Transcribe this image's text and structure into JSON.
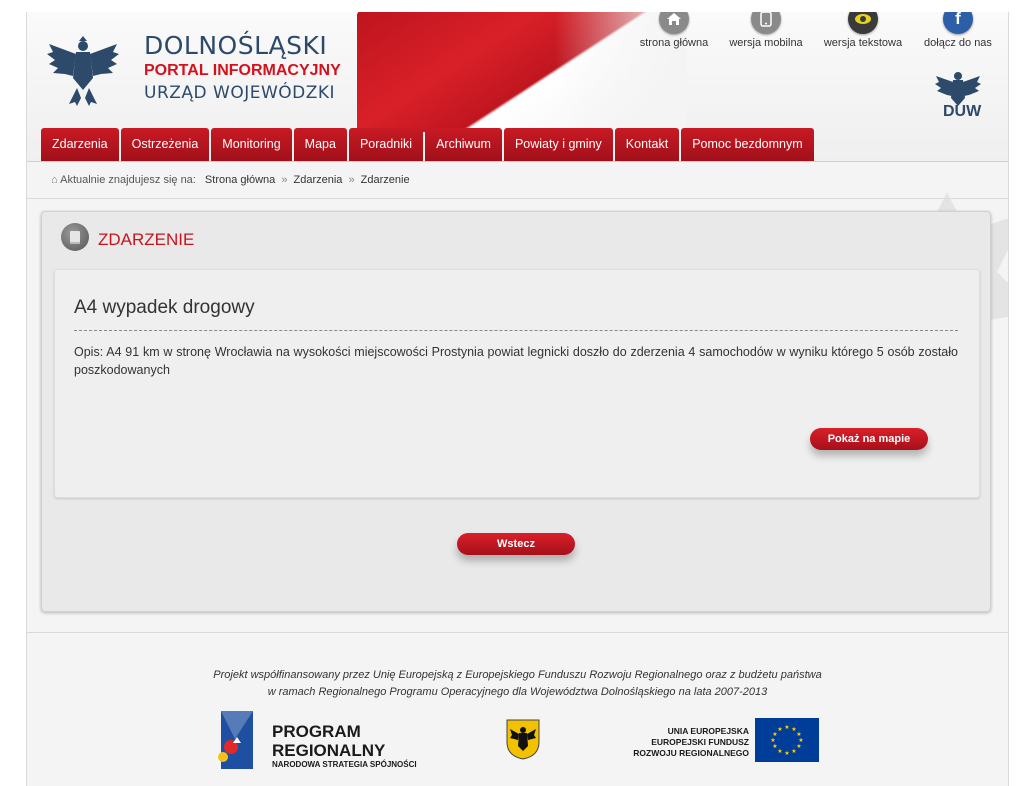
{
  "header": {
    "title_line1": "DOLNOŚLĄSKI",
    "title_line2": "PORTAL INFORMACYJNY",
    "title_line3": "URZĄD WOJEWÓDZKI",
    "duw_logo_text": "DUW",
    "top_links": [
      {
        "label": "strona główna",
        "icon": "home-icon",
        "color": "#8a8a8a"
      },
      {
        "label": "wersja mobilna",
        "icon": "mobile-icon",
        "color": "#8a8a8a"
      },
      {
        "label": "wersja tekstowa",
        "icon": "eye-icon",
        "color": "#3a3a3a"
      },
      {
        "label": "dołącz do nas",
        "icon": "facebook-icon",
        "color": "#2d5fa8"
      }
    ]
  },
  "nav": {
    "tabs": [
      "Zdarzenia",
      "Ostrzeżenia",
      "Monitoring",
      "Mapa",
      "Poradniki",
      "Archiwum",
      "Powiaty i gminy",
      "Kontakt",
      "Pomoc bezdomnym"
    ]
  },
  "breadcrumb": {
    "prefix": "Aktualnie znajdujesz się na:",
    "items": [
      "Strona główna",
      "Zdarzenia",
      "Zdarzenie"
    ]
  },
  "section": {
    "title": "ZDARZENIE",
    "event_title": "A4 wypadek drogowy",
    "description": "Opis: A4 91 km w stronę Wrocławia na wysokości miejscowości Prostynia powiat legnicki doszło do zderzenia 4 samochodów w wyniku którego 5 osób zostało poszkodowanych",
    "map_button": "Pokaż na mapie",
    "back_button": "Wstecz"
  },
  "footer": {
    "line1": "Projekt współfinansowany przez Unię Europejską z Europejskiego Funduszu Rozwoju Regionalnego oraz z budżetu państwa",
    "line2": "w ramach Regionalnego Programu Operacyjnego dla Województwa Dolnośląskiego na lata 2007-2013",
    "program_line1": "PROGRAM",
    "program_line2": "REGIONALNY",
    "program_line3": "NARODOWA STRATEGIA SPÓJNOŚCI",
    "ue_line1": "UNIA EUROPEJSKA",
    "ue_line2": "EUROPEJSKI FUNDUSZ",
    "ue_line3": "ROZWOJU REGIONALNEGO"
  },
  "colors": {
    "accent_red": "#c8141e",
    "navy": "#2d4a6a"
  }
}
